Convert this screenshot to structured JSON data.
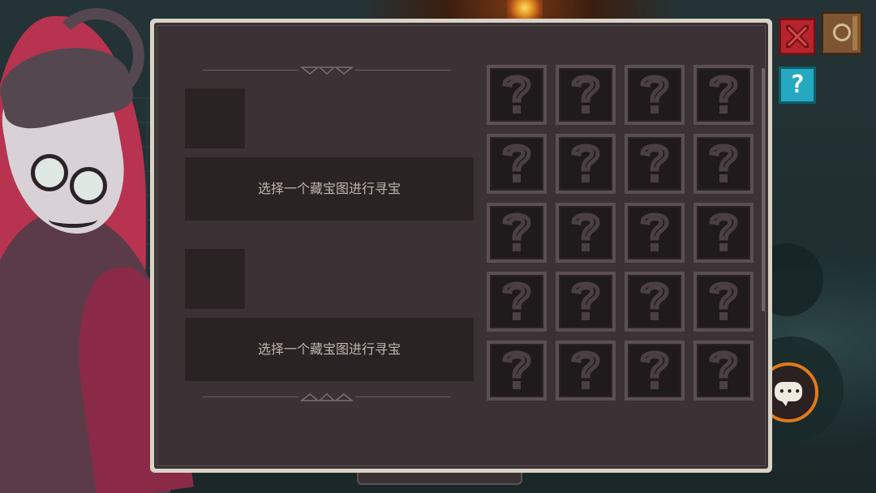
{
  "panel": {
    "slots": [
      {
        "label": "选择一个藏宝图进行寻宝"
      },
      {
        "label": "选择一个藏宝图进行寻宝"
      }
    ],
    "grid": {
      "rows": 5,
      "cols": 4,
      "cell_icon": "question-mark-icon"
    }
  },
  "hud": {
    "close_icon": "close-x-icon",
    "book_icon": "journal-clock-icon",
    "help_label": "?",
    "chat_icon": "chat-bubble-icon"
  },
  "colors": {
    "panel_border": "#d9d2c6",
    "panel_bg": "#3a3234",
    "slot_bg": "#2a2324",
    "cell_border": "#5a4f53",
    "close_red": "#b7242b",
    "help_cyan": "#25a9c0",
    "chat_orange": "#e07a1a"
  }
}
